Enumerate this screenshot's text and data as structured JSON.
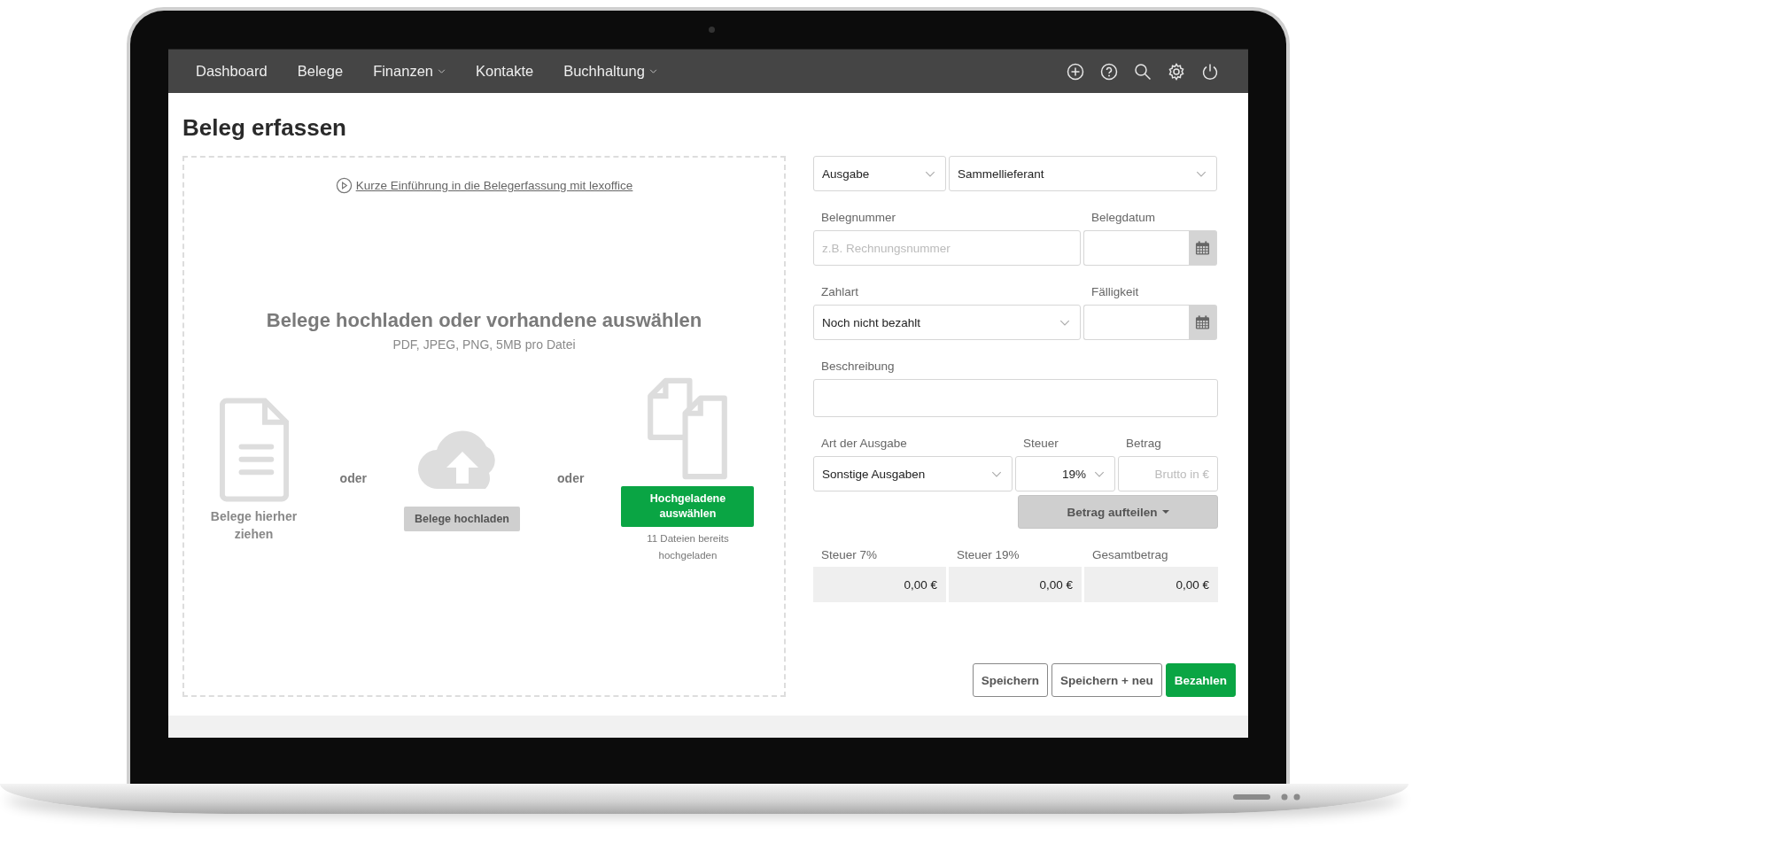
{
  "nav": {
    "items": [
      {
        "label": "Dashboard",
        "has_menu": false
      },
      {
        "label": "Belege",
        "has_menu": false
      },
      {
        "label": "Finanzen",
        "has_menu": true
      },
      {
        "label": "Kontakte",
        "has_menu": false
      },
      {
        "label": "Buchhaltung",
        "has_menu": true
      }
    ]
  },
  "page_title": "Beleg erfassen",
  "upload": {
    "intro_link": "Kurze Einführung in die Belegerfassung mit lexoffice",
    "heading": "Belege hochladen oder vorhandene auswählen",
    "formats": "PDF, JPEG, PNG, 5MB pro Datei",
    "options": [
      {
        "kind": "drop",
        "label": "Belege hierher ziehen"
      },
      {
        "kind": "separator",
        "label": "oder"
      },
      {
        "kind": "upload",
        "button": "Belege hochladen"
      },
      {
        "kind": "separator",
        "label": "oder"
      },
      {
        "kind": "existing",
        "button": "Hochgeladene auswählen",
        "note": "11 Dateien bereits hochgeladen"
      }
    ]
  },
  "form": {
    "rows": [
      [
        {
          "kind": "select",
          "value": "Ausgabe"
        },
        {
          "kind": "select",
          "value": "Sammellieferant"
        }
      ],
      [
        {
          "kind": "input",
          "label": "Belegnummer",
          "placeholder": "z.B. Rechnungsnummer"
        },
        {
          "kind": "date",
          "label": "Belegdatum"
        }
      ],
      [
        {
          "kind": "select",
          "label": "Zahlart",
          "value": "Noch nicht bezahlt"
        },
        {
          "kind": "date",
          "label": "Fälligkeit"
        }
      ],
      [
        {
          "kind": "textarea",
          "label": "Beschreibung"
        }
      ],
      [
        {
          "kind": "select",
          "label": "Art der Ausgabe",
          "value": "Sonstige Ausgaben"
        },
        {
          "kind": "select",
          "label": "Steuer",
          "value": "19%"
        },
        {
          "kind": "input",
          "label": "Betrag",
          "placeholder": "Brutto in €"
        }
      ]
    ],
    "split_button": "Betrag aufteilen",
    "totals": [
      {
        "label": "Steuer 7%",
        "value": "0,00 €"
      },
      {
        "label": "Steuer 19%",
        "value": "0,00 €"
      },
      {
        "label": "Gesamtbetrag",
        "value": "0,00 €"
      }
    ]
  },
  "actions": [
    {
      "label": "Speichern",
      "primary": false
    },
    {
      "label": "Speichern + neu",
      "primary": false
    },
    {
      "label": "Bezahlen",
      "primary": true
    }
  ]
}
